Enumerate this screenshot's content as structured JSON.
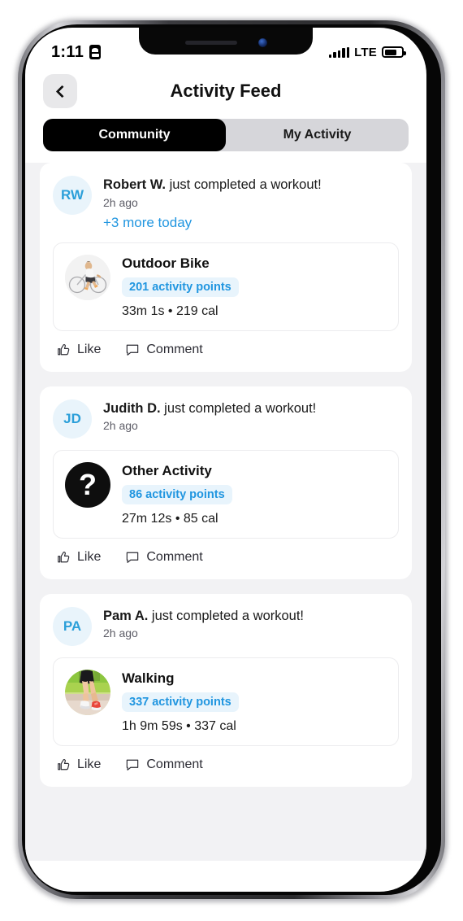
{
  "status_bar": {
    "time": "1:11",
    "location_icon": "location-services-icon",
    "network": "LTE",
    "signal_icon": "signal-bars-icon",
    "battery_icon": "battery-icon"
  },
  "header": {
    "back_icon": "chevron-left-icon",
    "title": "Activity Feed"
  },
  "tabs": [
    {
      "label": "Community",
      "active": true
    },
    {
      "label": "My Activity",
      "active": false
    }
  ],
  "colors": {
    "accent_blue": "#2196e0",
    "badge_bg": "#e8f4fc",
    "avatar_bg": "#e9f4fb",
    "page_bg": "#f2f2f4",
    "active_tab_bg": "#000000"
  },
  "feed": [
    {
      "avatar_initials": "RW",
      "user": "Robert W.",
      "action": "just completed a workout!",
      "time": "2h ago",
      "more_link": "+3 more today",
      "workout": {
        "icon": "outdoor-bike-photo",
        "name": "Outdoor Bike",
        "points": "201 activity points",
        "stats": "33m 1s • 219 cal"
      },
      "like_label": "Like",
      "comment_label": "Comment"
    },
    {
      "avatar_initials": "JD",
      "user": "Judith D.",
      "action": "just completed a workout!",
      "time": "2h ago",
      "more_link": "",
      "workout": {
        "icon": "question-mark-icon",
        "name": "Other Activity",
        "points": "86 activity points",
        "stats": "27m 12s • 85 cal"
      },
      "like_label": "Like",
      "comment_label": "Comment"
    },
    {
      "avatar_initials": "PA",
      "user": "Pam A.",
      "action": "just completed a workout!",
      "time": "2h ago",
      "more_link": "",
      "workout": {
        "icon": "walking-photo",
        "name": "Walking",
        "points": "337 activity points",
        "stats": "1h 9m 59s • 337 cal"
      },
      "like_label": "Like",
      "comment_label": "Comment"
    }
  ]
}
